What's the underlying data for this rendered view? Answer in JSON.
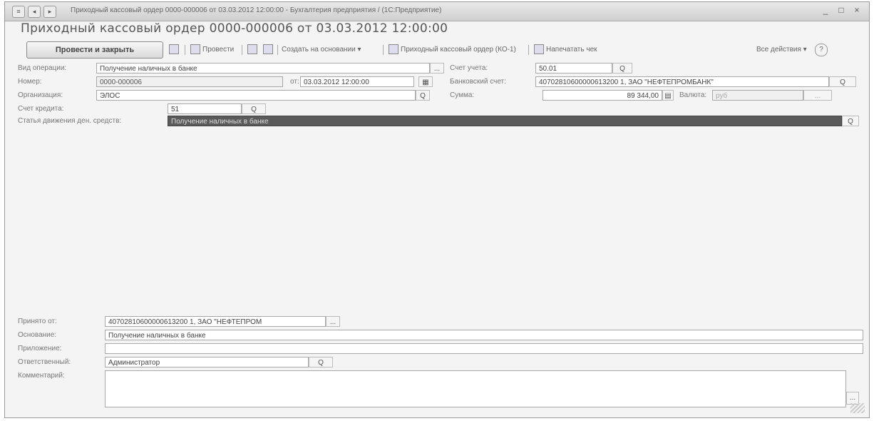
{
  "window": {
    "title": "Приходный кассовый ордер 0000-000006 от 03.03.2012 12:00:00 - Бухгалтерия предприятия / (1С:Предприятие)",
    "min_label": "_",
    "max_label": "□",
    "close_label": "×"
  },
  "document": {
    "title": "Приходный кассовый ордер 0000-000006 от 03.03.2012 12:00:00"
  },
  "toolbar": {
    "post_close_label": "Провести и закрыть",
    "post_label": "Провести",
    "create_based_label": "Создать на основании ▾",
    "print_form_label": "Приходный кассовый ордер (КО-1)",
    "debit_label": "Напечатать чек",
    "all_actions_label": "Все действия ▾",
    "help_label": "?"
  },
  "form": {
    "operation_type": {
      "label": "Вид операции:",
      "value": "Получение наличных в банке"
    },
    "account": {
      "label": "Счет учета:",
      "value": "50.01"
    },
    "number": {
      "label": "Номер:",
      "value": "0000-000006"
    },
    "date": {
      "label": "от:",
      "value": "03.03.2012 12:00:00"
    },
    "bank_account": {
      "label": "Банковский счет:",
      "value": "40702810600000613200 1, ЗАО \"НЕФТЕПРОМБАНК\""
    },
    "organization": {
      "label": "Организация:",
      "value": "ЭЛОС"
    },
    "sum": {
      "label": "Сумма:",
      "value": "89 344,00"
    },
    "currency": {
      "label": "Валюта:",
      "value": "руб"
    },
    "credit_account": {
      "label": "Счет кредита:",
      "value": "51"
    },
    "cash_flow": {
      "label": "Статья движения ден. средств:",
      "value": "Получение наличных в банке"
    },
    "received_from": {
      "label": "Принято от:",
      "value": "40702810600000613200 1, ЗАО \"НЕФТЕПРОМ"
    },
    "basis": {
      "label": "Основание:",
      "value": "Получение наличных в банке"
    },
    "attachment": {
      "label": "Приложение:",
      "value": ""
    },
    "responsible": {
      "label": "Ответственный:",
      "value": "Администратор"
    },
    "comment": {
      "label": "Комментарий:",
      "value": ""
    }
  },
  "icons": {
    "pick": "...",
    "open": "Q",
    "calendar": "▦",
    "calc": "▤"
  }
}
